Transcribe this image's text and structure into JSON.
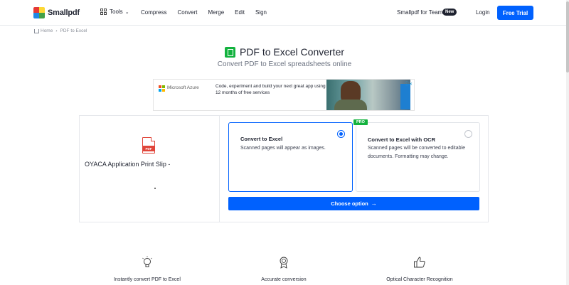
{
  "header": {
    "logo_text": "Smallpdf",
    "logo_colors": [
      "#e53935",
      "#fdd835",
      "#43a047",
      "#1e88e5"
    ],
    "tools_label": "Tools",
    "nav": [
      "Compress",
      "Convert",
      "Merge",
      "Edit",
      "Sign"
    ],
    "teams_label": "Smallpdf for Teams",
    "new_badge": "New",
    "login_label": "Login",
    "trial_label": "Free Trial",
    "accent": "#0061fe"
  },
  "breadcrumb": {
    "home": "Home",
    "current": "PDF to Excel"
  },
  "hero": {
    "title": "PDF to Excel Converter",
    "subtitle": "Convert PDF to Excel spreadsheets online",
    "icon_color": "#13b23e"
  },
  "ad": {
    "brand": "Microsoft Azure",
    "headline": "Code, experiment and build your next great app using 12 months of free services",
    "close": "ⓘ✕"
  },
  "converter": {
    "file_badge": "PDF",
    "filename": "OYACA Application Print Slip -",
    "options": [
      {
        "title": "Convert to Excel",
        "description": "Scanned pages will appear as images.",
        "selected": true
      },
      {
        "title": "Convert to Excel with OCR",
        "description": "Scanned pages will be converted to editable documents. Formatting may change.",
        "badge": "PRO",
        "selected": false
      }
    ],
    "choose_label": "Choose option",
    "choose_arrow": "→"
  },
  "features": [
    {
      "label": "Instantly convert PDF to Excel",
      "icon": "lightbulb-icon"
    },
    {
      "label": "Accurate conversion",
      "icon": "award-ribbon-icon"
    },
    {
      "label": "Optical Character Recognition",
      "icon": "thumbs-up-icon"
    }
  ]
}
